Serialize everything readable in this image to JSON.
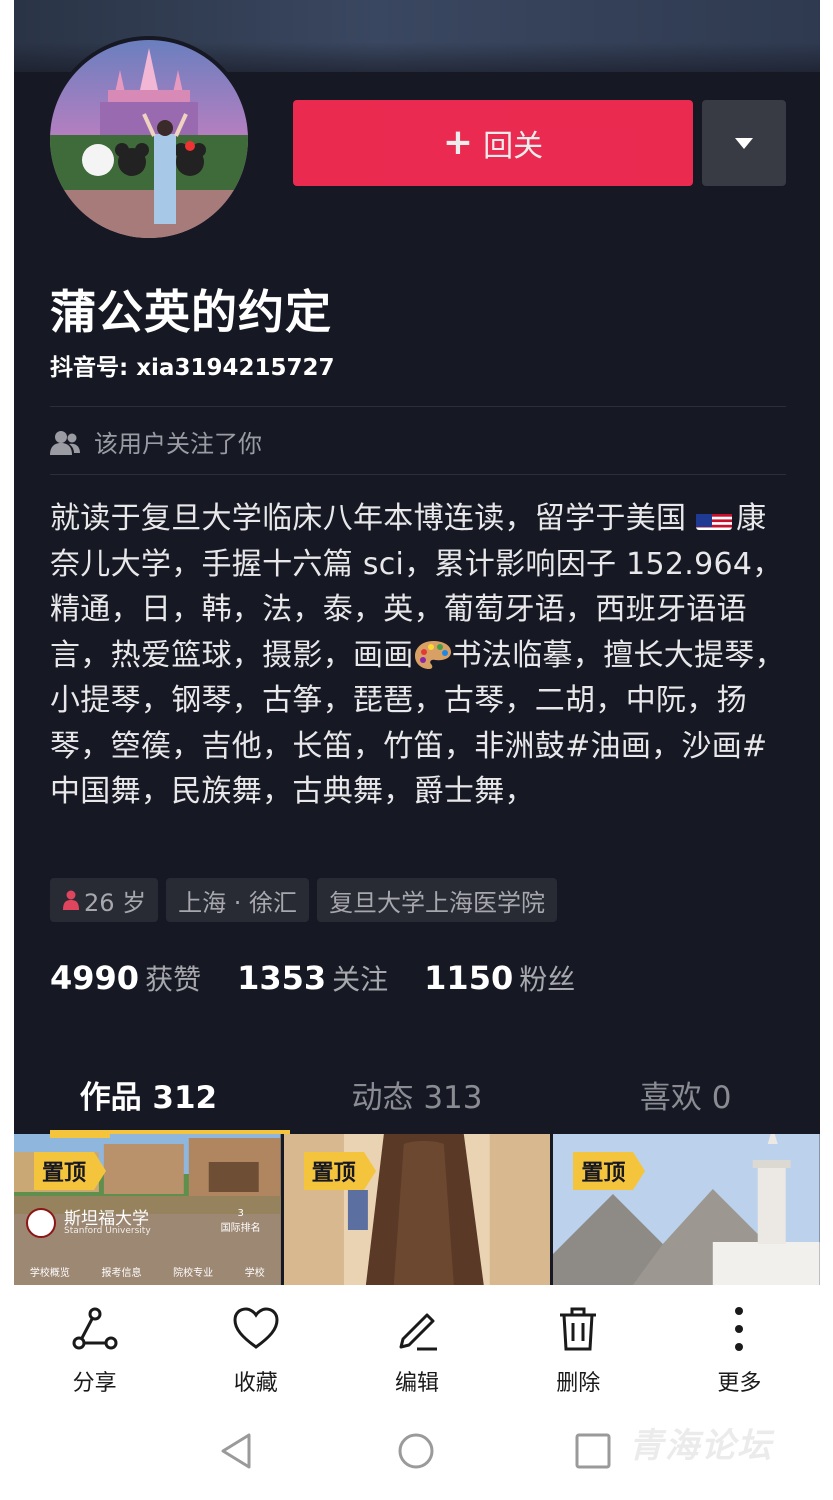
{
  "profile": {
    "follow_button": "回关",
    "nickname": "蒲公英的约定",
    "douyin_id": "抖音号: xia3194215727",
    "follows_you": "该用户关注了你",
    "bio_part1": "就读于复旦大学临床八年本博连读，留学于美国",
    "bio_part2": "康奈儿大学，手握十六篇 sci，累计影响因子 152.964，精通，日，韩，法，泰，英，葡萄牙语，西班牙语语言，热爱篮球，摄影，画画",
    "bio_part3": "书法临摹，擅长大提琴，小提琴，钢琴，古筝，琵琶，古琴，二胡，中阮，扬琴，箜篌，吉他，长笛，竹笛，非洲鼓#油画，沙画#中国舞，民族舞，古典舞，爵士舞，",
    "tags": {
      "age": "26 岁",
      "location": "上海 · 徐汇",
      "school": "复旦大学上海医学院"
    },
    "stats": {
      "likes_num": "4990",
      "likes_label": "获赞",
      "following_num": "1353",
      "following_label": "关注",
      "followers_num": "1150",
      "followers_label": "粉丝"
    }
  },
  "tabs": {
    "works": "作品 312",
    "moments": "动态 313",
    "likes": "喜欢 0"
  },
  "grid": {
    "pin_label": "置顶",
    "stanford_name": "斯坦福大学",
    "stanford_sub": "Stanford University",
    "stanford_rank_num": "3",
    "stanford_rank_label": "国际排名",
    "stanford_nav": [
      "学校概览",
      "报考信息",
      "院校专业",
      "学校"
    ]
  },
  "actions": {
    "share": "分享",
    "favorite": "收藏",
    "edit": "编辑",
    "delete": "删除",
    "more": "更多"
  },
  "colors": {
    "background": "#161823",
    "follow_button": "#fe2c55",
    "pin_badge": "#f5c43d",
    "tab_indicator": "#f5c43d"
  },
  "watermark": "青海论坛"
}
